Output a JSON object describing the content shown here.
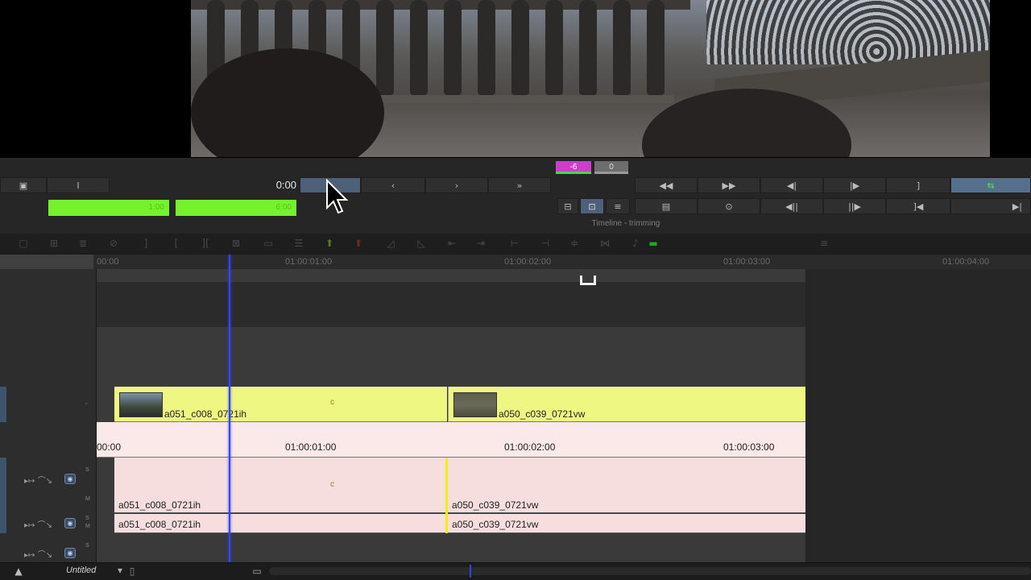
{
  "transport": {
    "timecode": "0:00",
    "trim_counter_a": "-6",
    "trim_counter_b": "0",
    "mode_label": "Timeline - trimming",
    "green_field_a": "1:00",
    "green_field_b": "6:00",
    "colors": {
      "active": "#4e6078",
      "trim_magenta": "#cc3fcc",
      "green": "#74f32c"
    }
  },
  "ruler_top": {
    "ticks": [
      "00:00",
      "01:00:01:00",
      "01:00:02:00",
      "01:00:03:00",
      "01:00:04:00"
    ]
  },
  "ruler_pink": {
    "ticks": [
      "00:00",
      "01:00:01:00",
      "01:00:02:00",
      "01:00:03:00"
    ]
  },
  "tracks": {
    "video": {
      "clips": [
        "a051_c008_0721ih",
        "a050_c039_0721vw"
      ],
      "marker": "c"
    },
    "audio1": {
      "clips": [
        "a051_c008_0721ih",
        "a050_c039_0721vw"
      ],
      "marker": "c"
    },
    "audio2": {
      "clips": [
        "a051_c008_0721ih",
        "a050_c039_0721vw"
      ]
    },
    "header_labels": {
      "s": "S",
      "m": "M"
    }
  },
  "bottom": {
    "sequence_name": "Untitled"
  }
}
